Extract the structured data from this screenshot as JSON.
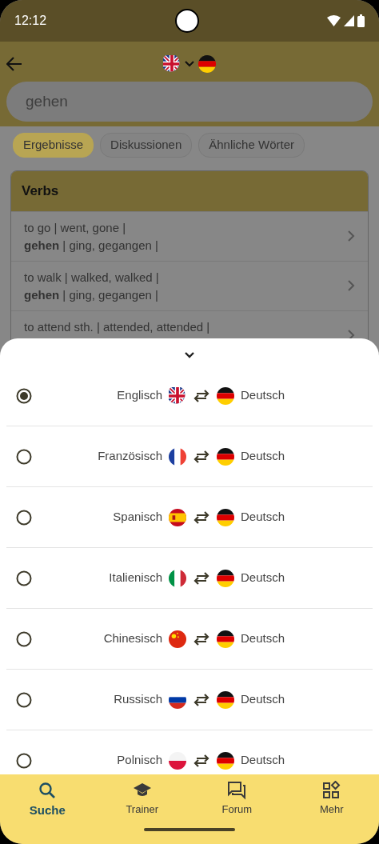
{
  "status_bar": {
    "time": "12:12"
  },
  "search": {
    "value": "gehen"
  },
  "filter_chips": [
    {
      "label": "Ergebnisse",
      "selected": true
    },
    {
      "label": "Diskussionen",
      "selected": false
    },
    {
      "label": "Ähnliche Wörter",
      "selected": false
    }
  ],
  "results": {
    "title": "Verbs",
    "entries": [
      {
        "lines": [
          "to go  | went, gone |",
          "**gehen**  | ging, gegangen |"
        ]
      },
      {
        "lines": [
          "to walk  | walked, walked |",
          "**gehen**  | ging, gegangen |"
        ]
      },
      {
        "lines": [
          "to attend sth.  | attended, attended |"
        ]
      }
    ]
  },
  "language_sheet": {
    "pairs": [
      {
        "kind": "english",
        "source": "Englisch",
        "target": "Deutsch",
        "selected": true
      },
      {
        "kind": "french",
        "source": "Französisch",
        "target": "Deutsch",
        "selected": false
      },
      {
        "kind": "spanish",
        "source": "Spanisch",
        "target": "Deutsch",
        "selected": false
      },
      {
        "kind": "italian",
        "source": "Italienisch",
        "target": "Deutsch",
        "selected": false
      },
      {
        "kind": "chinese",
        "source": "Chinesisch",
        "target": "Deutsch",
        "selected": false
      },
      {
        "kind": "russian",
        "source": "Russisch",
        "target": "Deutsch",
        "selected": false
      },
      {
        "kind": "polish",
        "source": "Polnisch",
        "target": "Deutsch",
        "selected": false
      }
    ]
  },
  "bottom_nav": [
    {
      "label": "Suche",
      "kind": "search",
      "selected": true
    },
    {
      "label": "Trainer",
      "kind": "trainer",
      "selected": false
    },
    {
      "label": "Forum",
      "kind": "forum",
      "selected": false
    },
    {
      "label": "Mehr",
      "kind": "more",
      "selected": false
    }
  ]
}
